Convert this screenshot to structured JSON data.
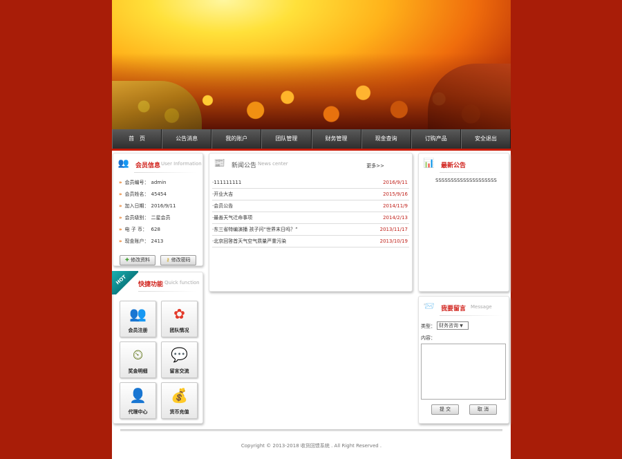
{
  "nav": [
    "首　页",
    "公告消息",
    "我的账户",
    "团队管理",
    "财务管理",
    "现金查询",
    "订购产品",
    "安全退出"
  ],
  "member": {
    "title": "会员信息",
    "subtitle": "User Information",
    "rows": [
      {
        "k": "会员编号：",
        "v": "admin"
      },
      {
        "k": "会员姓名：",
        "v": "45454"
      },
      {
        "k": "加入日期：",
        "v": "2016/9/11"
      },
      {
        "k": "会员级别：",
        "v": "二星会员"
      },
      {
        "k": "电 子 币：",
        "v": "628"
      },
      {
        "k": "现金账户：",
        "v": "2413"
      }
    ],
    "btn_edit": "修改资料",
    "btn_pwd": "修改密码",
    "icon": "users-icon"
  },
  "quick": {
    "title": "快捷功能",
    "subtitle": "Quick function",
    "hot": "HOT",
    "tiles": [
      {
        "label": "会员注册",
        "icon": "users-register-icon"
      },
      {
        "label": "团队情况",
        "icon": "team-flower-icon"
      },
      {
        "label": "奖金明细",
        "icon": "clock-money-icon"
      },
      {
        "label": "留言交流",
        "icon": "chat-icon"
      },
      {
        "label": "代理中心",
        "icon": "agent-icon"
      },
      {
        "label": "货币充值",
        "icon": "money-bag-icon"
      }
    ]
  },
  "news": {
    "title": "新闻公告",
    "subtitle": "News center",
    "more": "更多>>",
    "icon": "newspaper-icon",
    "items": [
      {
        "t": "·111111111",
        "d": "2016/9/11"
      },
      {
        "t": "·开业大吉",
        "d": "2015/9/16"
      },
      {
        "t": "·会员公告",
        "d": "2014/11/9"
      },
      {
        "t": "·最善天气迁命事项",
        "d": "2014/2/13"
      },
      {
        "t": "·东三省特编演播 孩子问“世界末日吗？”",
        "d": "2013/11/17"
      },
      {
        "t": "·北京回答首天气空气质量严重污染",
        "d": "2013/10/19"
      }
    ]
  },
  "latest": {
    "title": "最新公告",
    "icon": "chart-icon",
    "text": "SSSSSSSSSSSSSSSSSSSS"
  },
  "message": {
    "title": "我要留言",
    "subtitle": "Message",
    "icon": "message-icon",
    "type_label": "类型：",
    "type_value": "财务咨询",
    "content_label": "内容：",
    "submit": "提 交",
    "cancel": "取 消"
  },
  "footer": {
    "copyright": "Copyright © 2013-2018 收货回馈系统 . All Right Reserved ."
  },
  "colors": {
    "background": "#a81d08",
    "accent": "#d0211b",
    "date": "#c0211a"
  }
}
